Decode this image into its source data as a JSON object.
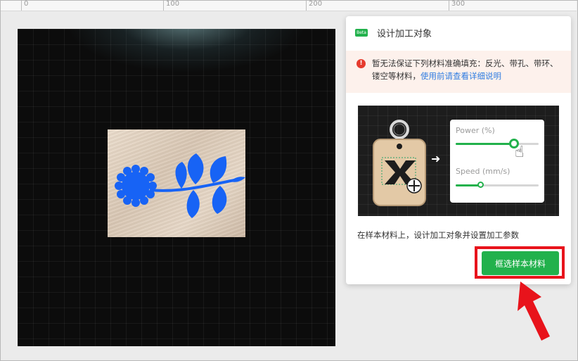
{
  "ruler": {
    "labels": [
      "0",
      "100",
      "200",
      "300"
    ]
  },
  "panel": {
    "badge": "Beta",
    "title": "设计加工对象",
    "warning_icon": "alert-icon",
    "warning_text": "暂无法保证下列材料准确填充：反光、带孔、带环、镂空等材料，",
    "warning_link": "使用前请查看详细说明",
    "illustration": {
      "power_label": "Power (%)",
      "speed_label": "Speed (mm/s)",
      "power_value": 0.7,
      "speed_value": 0.3
    },
    "instruction": "在样本材料上，设计加工对象并设置加工参数",
    "select_button": "框选样本材料"
  },
  "colors": {
    "accent": "#22b14c",
    "highlight": "#e8131b",
    "design_blue": "#1763f5"
  }
}
